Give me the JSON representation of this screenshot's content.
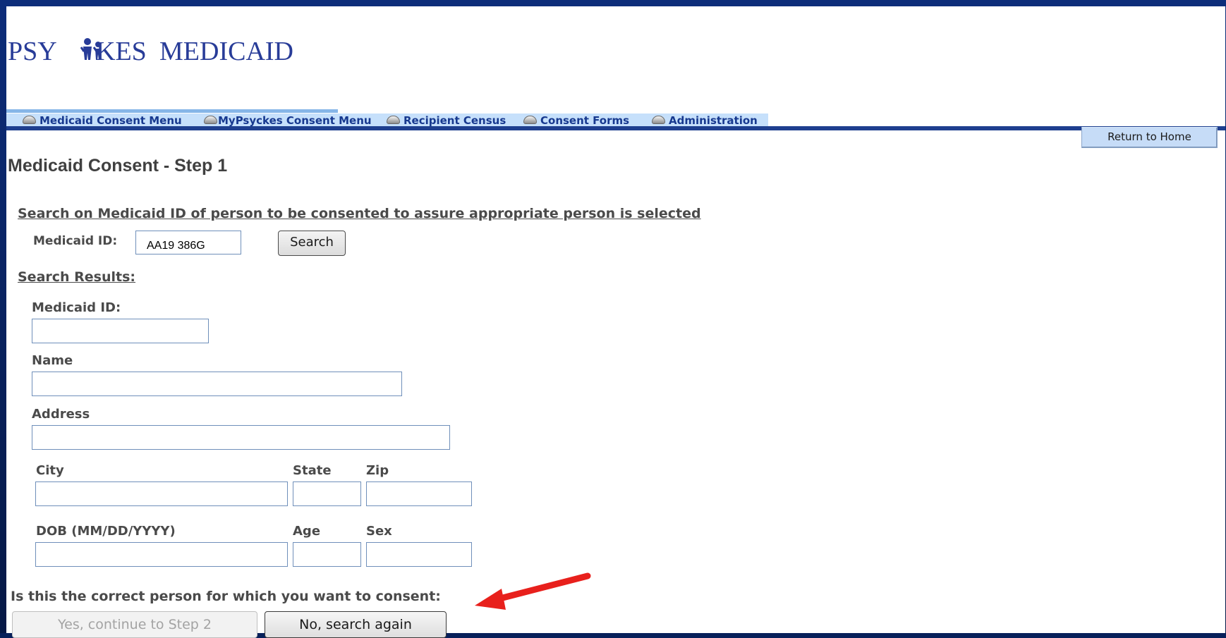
{
  "logo": {
    "prefix": "PSY",
    "suffix": "KES",
    "word": "MEDICAID",
    "brand_color": "#283c98"
  },
  "nav": {
    "items": [
      {
        "label": "Medicaid Consent Menu",
        "icon": "bullet-icon"
      },
      {
        "label": "MyPsyckes Consent Menu",
        "icon": "bullet-icon"
      },
      {
        "label": "Recipient Census",
        "icon": "bullet-icon"
      },
      {
        "label": "Consent Forms",
        "icon": "bullet-icon"
      },
      {
        "label": "Administration",
        "icon": "bullet-icon"
      }
    ],
    "active_index": 0
  },
  "return_home_label": "Return to Home",
  "page_title": "Medicaid Consent - Step 1",
  "search": {
    "heading": "Search on Medicaid ID of person to be consented to assure appropriate person is selected",
    "id_label": "Medicaid ID:",
    "id_value": "AA19 386G",
    "button_label": "Search"
  },
  "results": {
    "heading": "Search Results:",
    "labels": {
      "medicaid_id": "Medicaid ID:",
      "name": "Name",
      "address": "Address",
      "city": "City",
      "state": "State",
      "zip": "Zip",
      "dob": "DOB (MM/DD/YYYY)",
      "age": "Age",
      "sex": "Sex"
    },
    "values": {
      "medicaid_id": "",
      "name": "",
      "address": "",
      "city": "",
      "state": "",
      "zip": "",
      "dob": "",
      "age": "",
      "sex": ""
    }
  },
  "confirm": {
    "question": "Is this the correct person for which you want to consent:",
    "yes_label": "Yes, continue to Step 2",
    "no_label": "No, search again",
    "annotation_color": "#e8201c"
  }
}
